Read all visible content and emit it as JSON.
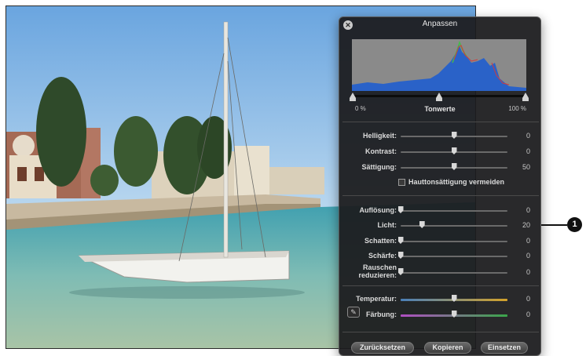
{
  "panel": {
    "title": "Anpassen",
    "histogram": {
      "range_min_label": "0 %",
      "range_max_label": "100 %",
      "caption": "Tonwerte"
    },
    "sliders": {
      "helligkeit": {
        "label": "Helligkeit:",
        "value": "0",
        "level": 0.5
      },
      "kontrast": {
        "label": "Kontrast:",
        "value": "0",
        "level": 0.5
      },
      "saettigung": {
        "label": "Sättigung:",
        "value": "50",
        "level": 0.5
      },
      "aufloesung": {
        "label": "Auflösung:",
        "value": "0",
        "level": 0.0
      },
      "licht": {
        "label": "Licht:",
        "value": "20",
        "level": 0.2
      },
      "schatten": {
        "label": "Schatten:",
        "value": "0",
        "level": 0.0
      },
      "schaerfe": {
        "label": "Schärfe:",
        "value": "0",
        "level": 0.0
      },
      "rauschen": {
        "label_line1": "Rauschen",
        "label_line2": "reduzieren:",
        "value": "0",
        "level": 0.0
      },
      "temperatur": {
        "label": "Temperatur:",
        "value": "0",
        "level": 0.5
      },
      "faerbung": {
        "label": "Färbung:",
        "value": "0",
        "level": 0.5
      }
    },
    "checkbox": {
      "label": "Hauttonsättigung vermeiden",
      "checked": false
    },
    "buttons": {
      "reset": "Zurücksetzen",
      "copy": "Kopieren",
      "paste": "Einsetzen"
    }
  },
  "callout": {
    "number": "1"
  },
  "icons": {
    "close": "close-icon",
    "eyedropper": "eyedropper-icon"
  },
  "colors": {
    "panel_bg": "#1c1c1e",
    "histogram_blue": "#2a62c8",
    "temperature_left": "#4a7fb8",
    "temperature_right": "#d4a22a",
    "tint_left": "#b04ec2",
    "tint_right": "#3aa64a"
  }
}
